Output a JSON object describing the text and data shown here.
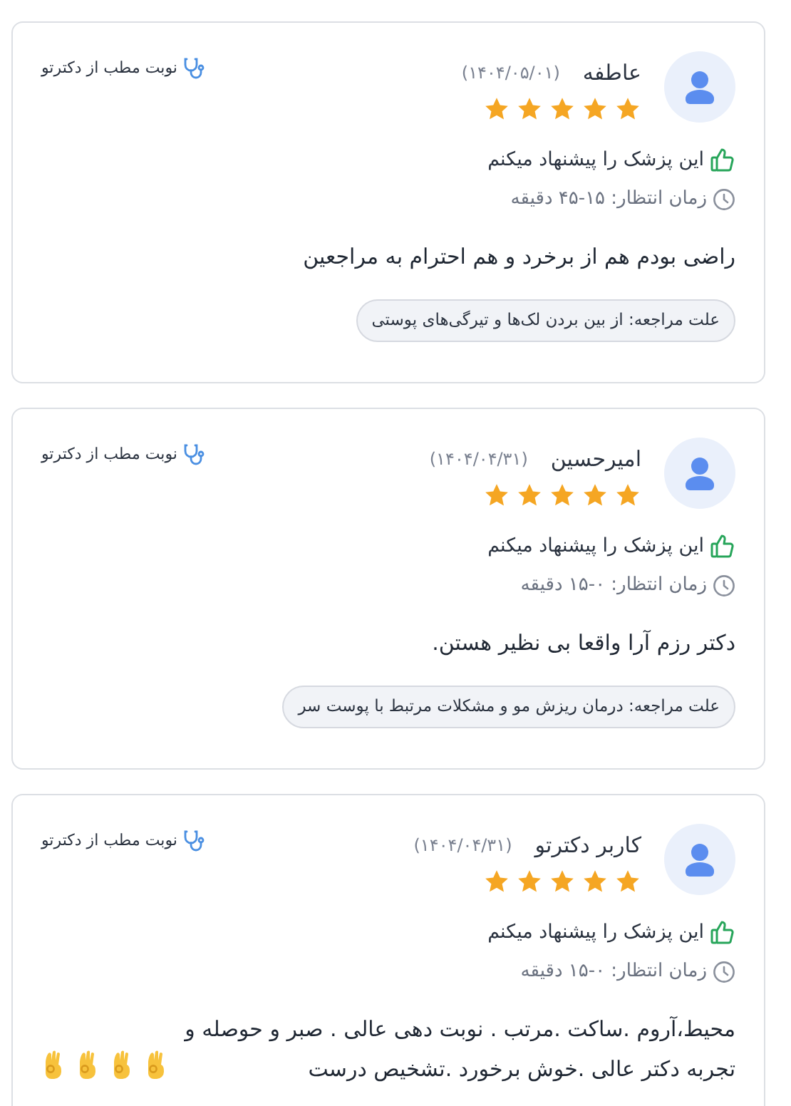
{
  "reviews": [
    {
      "name": "عاطفه",
      "date": "(۱۴۰۴/۰۵/۰۱)",
      "stars": 5,
      "source": "نوبت مطب از دکترتو",
      "recommend": "این پزشک را پیشنهاد میکنم",
      "wait_time": "زمان انتظار: ۱۵-۴۵ دقیقه",
      "comment": "راضی بودم هم از برخرد و هم احترام به مراجعین",
      "reason": "علت مراجعه: از بین بردن لک‌ها و تیرگی‌های پوستی"
    },
    {
      "name": "امیرحسین",
      "date": "(۱۴۰۴/۰۴/۳۱)",
      "stars": 5,
      "source": "نوبت مطب از دکترتو",
      "recommend": "این پزشک را پیشنهاد میکنم",
      "wait_time": "زمان انتظار: ۰-۱۵ دقیقه",
      "comment": "دکتر رزم آرا واقعا بی نظیر هستن.",
      "reason": "علت مراجعه: درمان ریزش مو و مشکلات مرتبط با پوست سر"
    },
    {
      "name": "کاربر دکترتو",
      "date": "(۱۴۰۴/۰۴/۳۱)",
      "stars": 5,
      "source": "نوبت مطب از دکترتو",
      "recommend": "این پزشک را پیشنهاد میکنم",
      "wait_time": "زمان انتظار: ۰-۱۵ دقیقه",
      "comment": "محیط،آروم .ساکت .مرتب . نوبت دهی عالی . صبر و حوصله و تجربه دکتر عالی .خوش برخورد .تشخیص درست",
      "reactions": [
        {
          "kind": "ok-hand"
        },
        {
          "kind": "ok-hand"
        },
        {
          "kind": "ok-hand"
        },
        {
          "kind": "ok-hand"
        }
      ]
    }
  ]
}
